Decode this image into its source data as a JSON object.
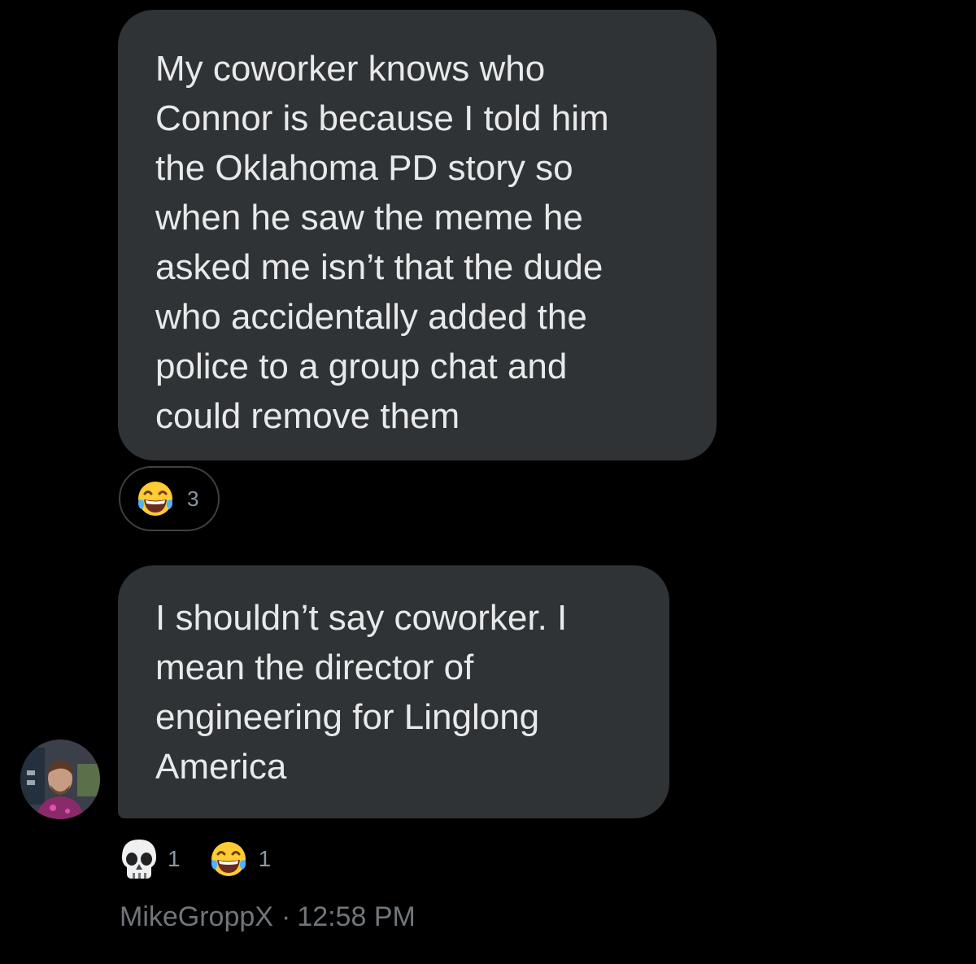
{
  "messages": [
    {
      "lines": [
        "My coworker knows who",
        "Connor is because I told him",
        "the Oklahoma PD story so",
        "when he saw the meme he",
        "asked me isn’t that the dude",
        "who accidentally added the",
        "police to a group chat and",
        "could remove them"
      ],
      "reactions": [
        {
          "icon": "laughing-tears-emoji-icon",
          "count": "3"
        }
      ]
    },
    {
      "lines": [
        "I shouldn’t say coworker. I",
        "mean the director of",
        "engineering for Linglong",
        "America"
      ],
      "reactions": [
        {
          "icon": "skull-emoji-icon",
          "count": "1"
        },
        {
          "icon": "laughing-tears-emoji-icon",
          "count": "1"
        }
      ]
    }
  ],
  "sender": {
    "username": "MikeGroppX",
    "separator": "·",
    "time": "12:58 PM"
  },
  "colors": {
    "background": "#000000",
    "bubble": "#2f3336",
    "text": "#e7e9ea",
    "meta": "#71767b"
  }
}
